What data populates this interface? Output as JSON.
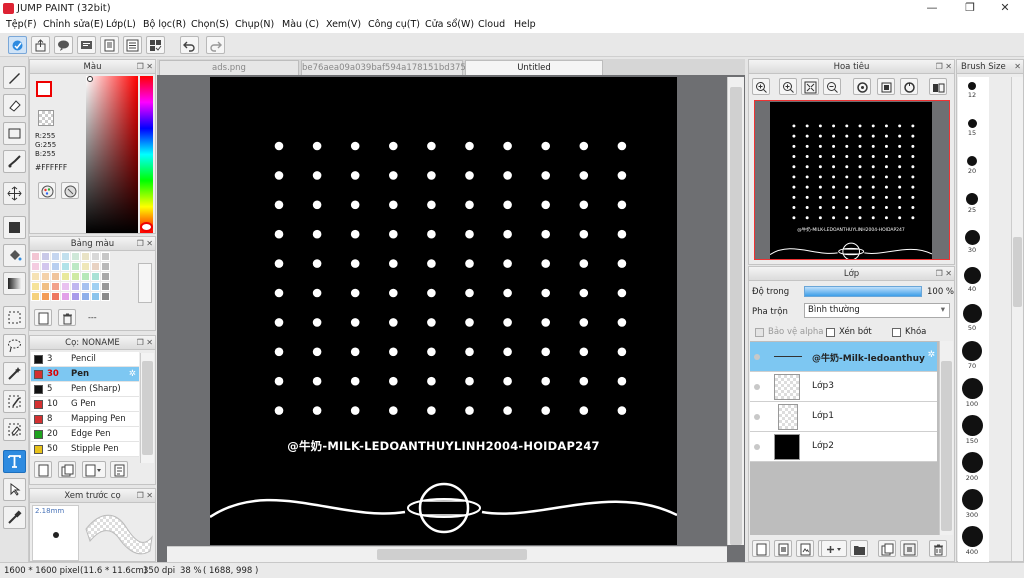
{
  "window": {
    "title": "JUMP PAINT (32bit)",
    "minimize": "—",
    "restore": "❐",
    "close": "✕"
  },
  "menu": [
    "Tệp(F)",
    "Chỉnh sửa(E)",
    "Lớp(L)",
    "Bộ lọc(R)",
    "Chọn(S)",
    "Chụp(N)",
    "Màu (C)",
    "Xem(V)",
    "Công cụ(T)",
    "Cửa sổ(W)",
    "Cloud",
    "Help"
  ],
  "toolbar": {
    "icons": [
      "brush-tool-icon",
      "export-icon",
      "speech-bubble-icon",
      "comment-icon",
      "page-icon",
      "layer-list-icon",
      "grid-page-icon",
      "undo-icon",
      "redo-icon"
    ]
  },
  "tabs": [
    {
      "label": "ads.png",
      "active": false
    },
    {
      "label": "be76aea09a039baf594a178151bd375a.jpg",
      "active": false
    },
    {
      "label": "Untitled",
      "active": true
    }
  ],
  "color_panel": {
    "title": "Màu",
    "r": "R:255",
    "g": "G:255",
    "b": "B:255",
    "hex": "#FFFFFF",
    "accent": "#ff0000"
  },
  "palette_panel": {
    "title": "Bảng màu",
    "swatches": [
      "#f3c6d3",
      "#c9c9e8",
      "#c5d6f0",
      "#c2e0ee",
      "#cfe8d8",
      "#e9e3c6",
      "#d8d8d8",
      "#c7c7c7",
      "#f4cde1",
      "#d3c7ee",
      "#b8cff0",
      "#b1e3e9",
      "#bde9c5",
      "#efe7b9",
      "#e9d3c3",
      "#b9b9b9",
      "#f6e3b5",
      "#f4d2aa",
      "#f0c49c",
      "#e9e99c",
      "#cfeaa3",
      "#b6e9b9",
      "#a8e2d6",
      "#a9a9a9",
      "#f6e39a",
      "#f0bf85",
      "#f2a28c",
      "#e9c2f0",
      "#c0b6f0",
      "#a7c1f0",
      "#a1d0f2",
      "#999999",
      "#f5d17d",
      "#f39c58",
      "#ee7862",
      "#e2a2e9",
      "#a89bea",
      "#8fb0ea",
      "#8cc4ec",
      "#8b8b8b"
    ],
    "menu_dots": "---"
  },
  "brush_panel": {
    "title": "Cọ: NONAME",
    "items": [
      {
        "num": "3",
        "name": "Pencil",
        "color": "#111111",
        "selected": false
      },
      {
        "num": "30",
        "name": "Pen",
        "color": "#d33030",
        "selected": true
      },
      {
        "num": "5",
        "name": "Pen (Sharp)",
        "color": "#111111",
        "selected": false
      },
      {
        "num": "10",
        "name": "G Pen",
        "color": "#d33030",
        "selected": false
      },
      {
        "num": "8",
        "name": "Mapping Pen",
        "color": "#d33030",
        "selected": false
      },
      {
        "num": "20",
        "name": "Edge Pen",
        "color": "#1fa21f",
        "selected": false
      },
      {
        "num": "50",
        "name": "Stipple Pen",
        "color": "#e8c21a",
        "selected": false
      }
    ]
  },
  "preview_panel": {
    "title": "Xem trước cọ",
    "size": "2.18mm"
  },
  "navigator": {
    "title": "Hoa tiêu"
  },
  "layers": {
    "title": "Lớp",
    "opacity_label": "Độ trong",
    "opacity_value": "100 %",
    "blend_label": "Pha trộn",
    "blend_value": "Bình thường",
    "protect_alpha": "Bảo vệ alpha",
    "clipping": "Xén bớt",
    "lock": "Khóa",
    "items": [
      {
        "name": "@牛奶-Milk-ledoanthuy",
        "selected": true,
        "thumb": "line"
      },
      {
        "name": "Lớp3",
        "selected": false,
        "thumb": "empty"
      },
      {
        "name": "Lớp1",
        "selected": false,
        "thumb": "empty-tall"
      },
      {
        "name": "Lớp2",
        "selected": false,
        "thumb": "black"
      }
    ]
  },
  "brush_size": {
    "title": "Brush Size",
    "sizes": [
      "12",
      "15",
      "20",
      "25",
      "30",
      "40",
      "50",
      "70",
      "100",
      "150",
      "200",
      "300",
      "400"
    ]
  },
  "canvas": {
    "signature": "@牛奶-MILK-LEDOANTHUYLINH2004-HOIDAP247",
    "dot_cols": 10,
    "dot_rows": 10,
    "bg": "#000000"
  },
  "status": {
    "size": "1600 * 1600 pixel",
    "physical": "(11.6 * 11.6cm)",
    "dpi": "350 dpi",
    "zoom": "38 %",
    "coords": "( 1688, 998 )"
  }
}
